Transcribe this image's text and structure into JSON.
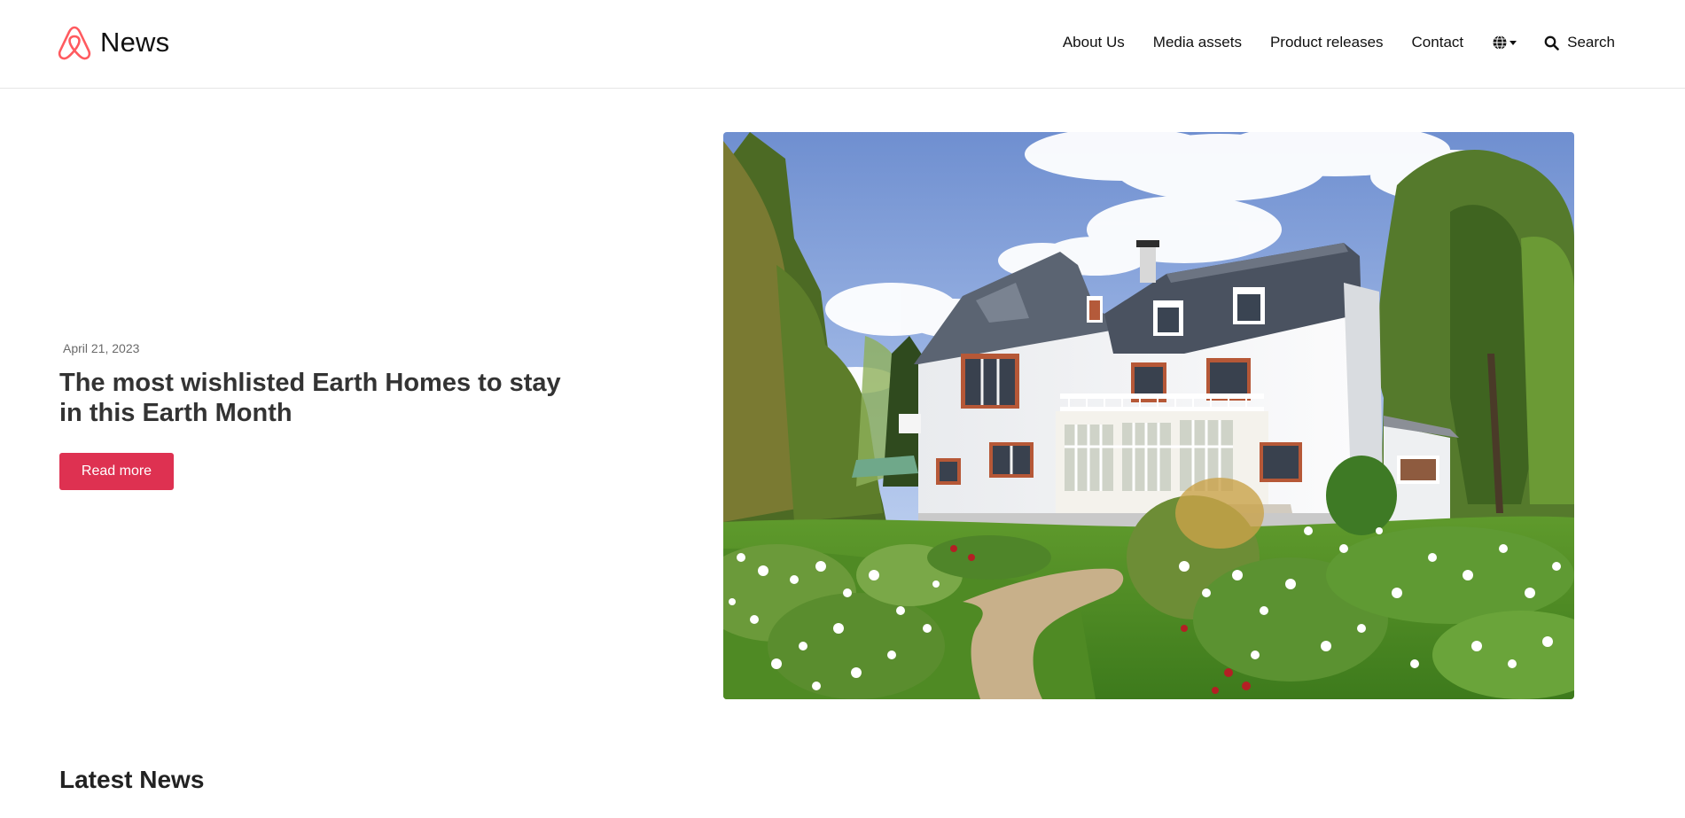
{
  "brand": {
    "name": "News",
    "logo_icon": "airbnb-belo-icon",
    "logo_color": "#ff5a5f"
  },
  "nav": {
    "links": [
      "About Us",
      "Media assets",
      "Product releases",
      "Contact"
    ],
    "language_icon": "globe-icon",
    "search_label": "Search",
    "search_icon": "search-icon"
  },
  "hero": {
    "date": "April 21, 2023",
    "title": "The most wishlisted Earth Homes to stay in this Earth Month",
    "button_label": "Read more",
    "button_color": "#de3151",
    "image_subject": "white house with dark roof surrounded by garden"
  },
  "latest": {
    "title": "Latest News"
  }
}
